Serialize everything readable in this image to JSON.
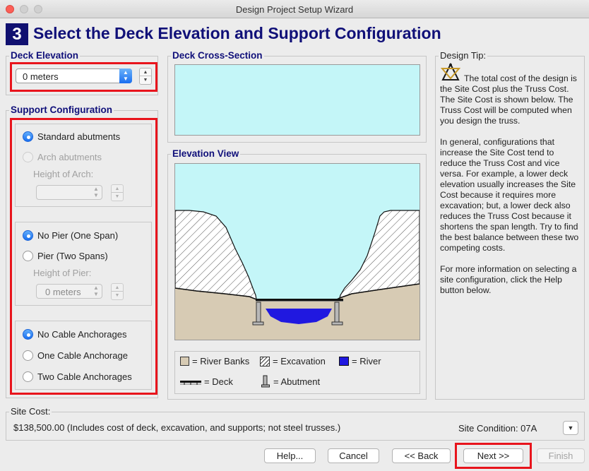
{
  "window": {
    "title": "Design Project Setup Wizard"
  },
  "header": {
    "step_number": "3",
    "title": "Select the Deck Elevation and Support Configuration"
  },
  "deck_elevation": {
    "label": "Deck Elevation",
    "value": "0 meters"
  },
  "deck_cross_section": {
    "label": "Deck Cross-Section"
  },
  "elevation_view": {
    "label": "Elevation View"
  },
  "support_configuration": {
    "label": "Support Configuration",
    "abutments": {
      "standard": "Standard abutments",
      "arch": "Arch abutments",
      "height_label": "Height of Arch:",
      "height_value": "",
      "selected": "standard"
    },
    "piers": {
      "no_pier": "No Pier (One Span)",
      "pier": "Pier (Two Spans)",
      "height_label": "Height of Pier:",
      "height_value": "0 meters",
      "selected": "no_pier"
    },
    "cables": {
      "none": "No Cable Anchorages",
      "one": "One Cable Anchorage",
      "two": "Two Cable Anchorages",
      "selected": "none"
    }
  },
  "legend": {
    "river_banks": "= River Banks",
    "excavation": "= Excavation",
    "river": "= River",
    "deck": "= Deck",
    "abutment": "= Abutment"
  },
  "design_tip": {
    "label": "Design Tip:",
    "p1": "The total cost of the design is the Site Cost plus the Truss Cost. The Site Cost is shown below. The Truss Cost will be computed when you design the truss.",
    "p2": "In general, configurations that increase the Site Cost tend to reduce the Truss Cost and vice versa. For example, a lower deck elevation usually increases the Site Cost because it requires more excavation; but, a lower deck also reduces the Truss Cost because it shortens the span length. Try to find the best balance between these two competing costs.",
    "p3": "For more information on selecting a site configuration, click the Help button below."
  },
  "site_cost": {
    "label": "Site Cost:",
    "value": "$138,500.00 (Includes cost of deck, excavation, and supports; not steel trusses.)",
    "condition": "Site Condition: 07A"
  },
  "buttons": {
    "help": "Help...",
    "cancel": "Cancel",
    "back": "<< Back",
    "next": "Next >>",
    "finish": "Finish"
  },
  "colors": {
    "title_blue": "#101078",
    "highlight_red": "#e8141c",
    "sky": "#c4f6f8",
    "river_bank": "#d7cbb4",
    "river": "#2018e0"
  }
}
